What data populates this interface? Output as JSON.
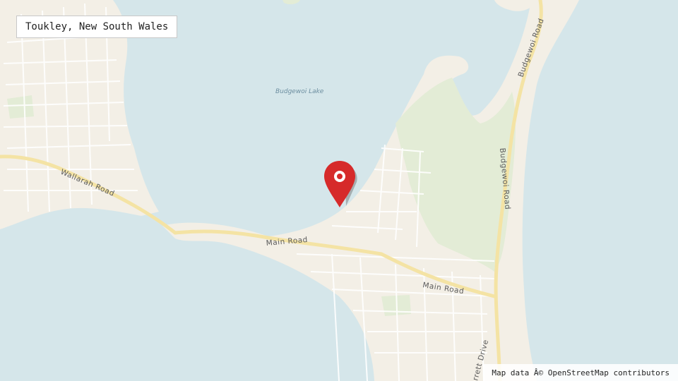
{
  "map": {
    "title": "Toukley, New South Wales",
    "attribution": "Map data Â© OpenStreetMap contributors",
    "marker": {
      "name": "location-marker",
      "color": "#d62a2a"
    },
    "colors": {
      "water": "#d5e6ea",
      "land": "#f3efe6",
      "park": "#e3ecd6",
      "major_road": "#f4e3a4",
      "minor_road": "#ffffff"
    },
    "labels": {
      "water": "Budgewoi Lake",
      "wallarah_road": "Wallarah Road",
      "main_road_west": "Main Road",
      "main_road_east": "Main Road",
      "budgewoi_road_north": "Budgewoi Road",
      "budgewoi_road_south": "Budgewoi Road",
      "partial_road": "rrett Drive"
    }
  }
}
